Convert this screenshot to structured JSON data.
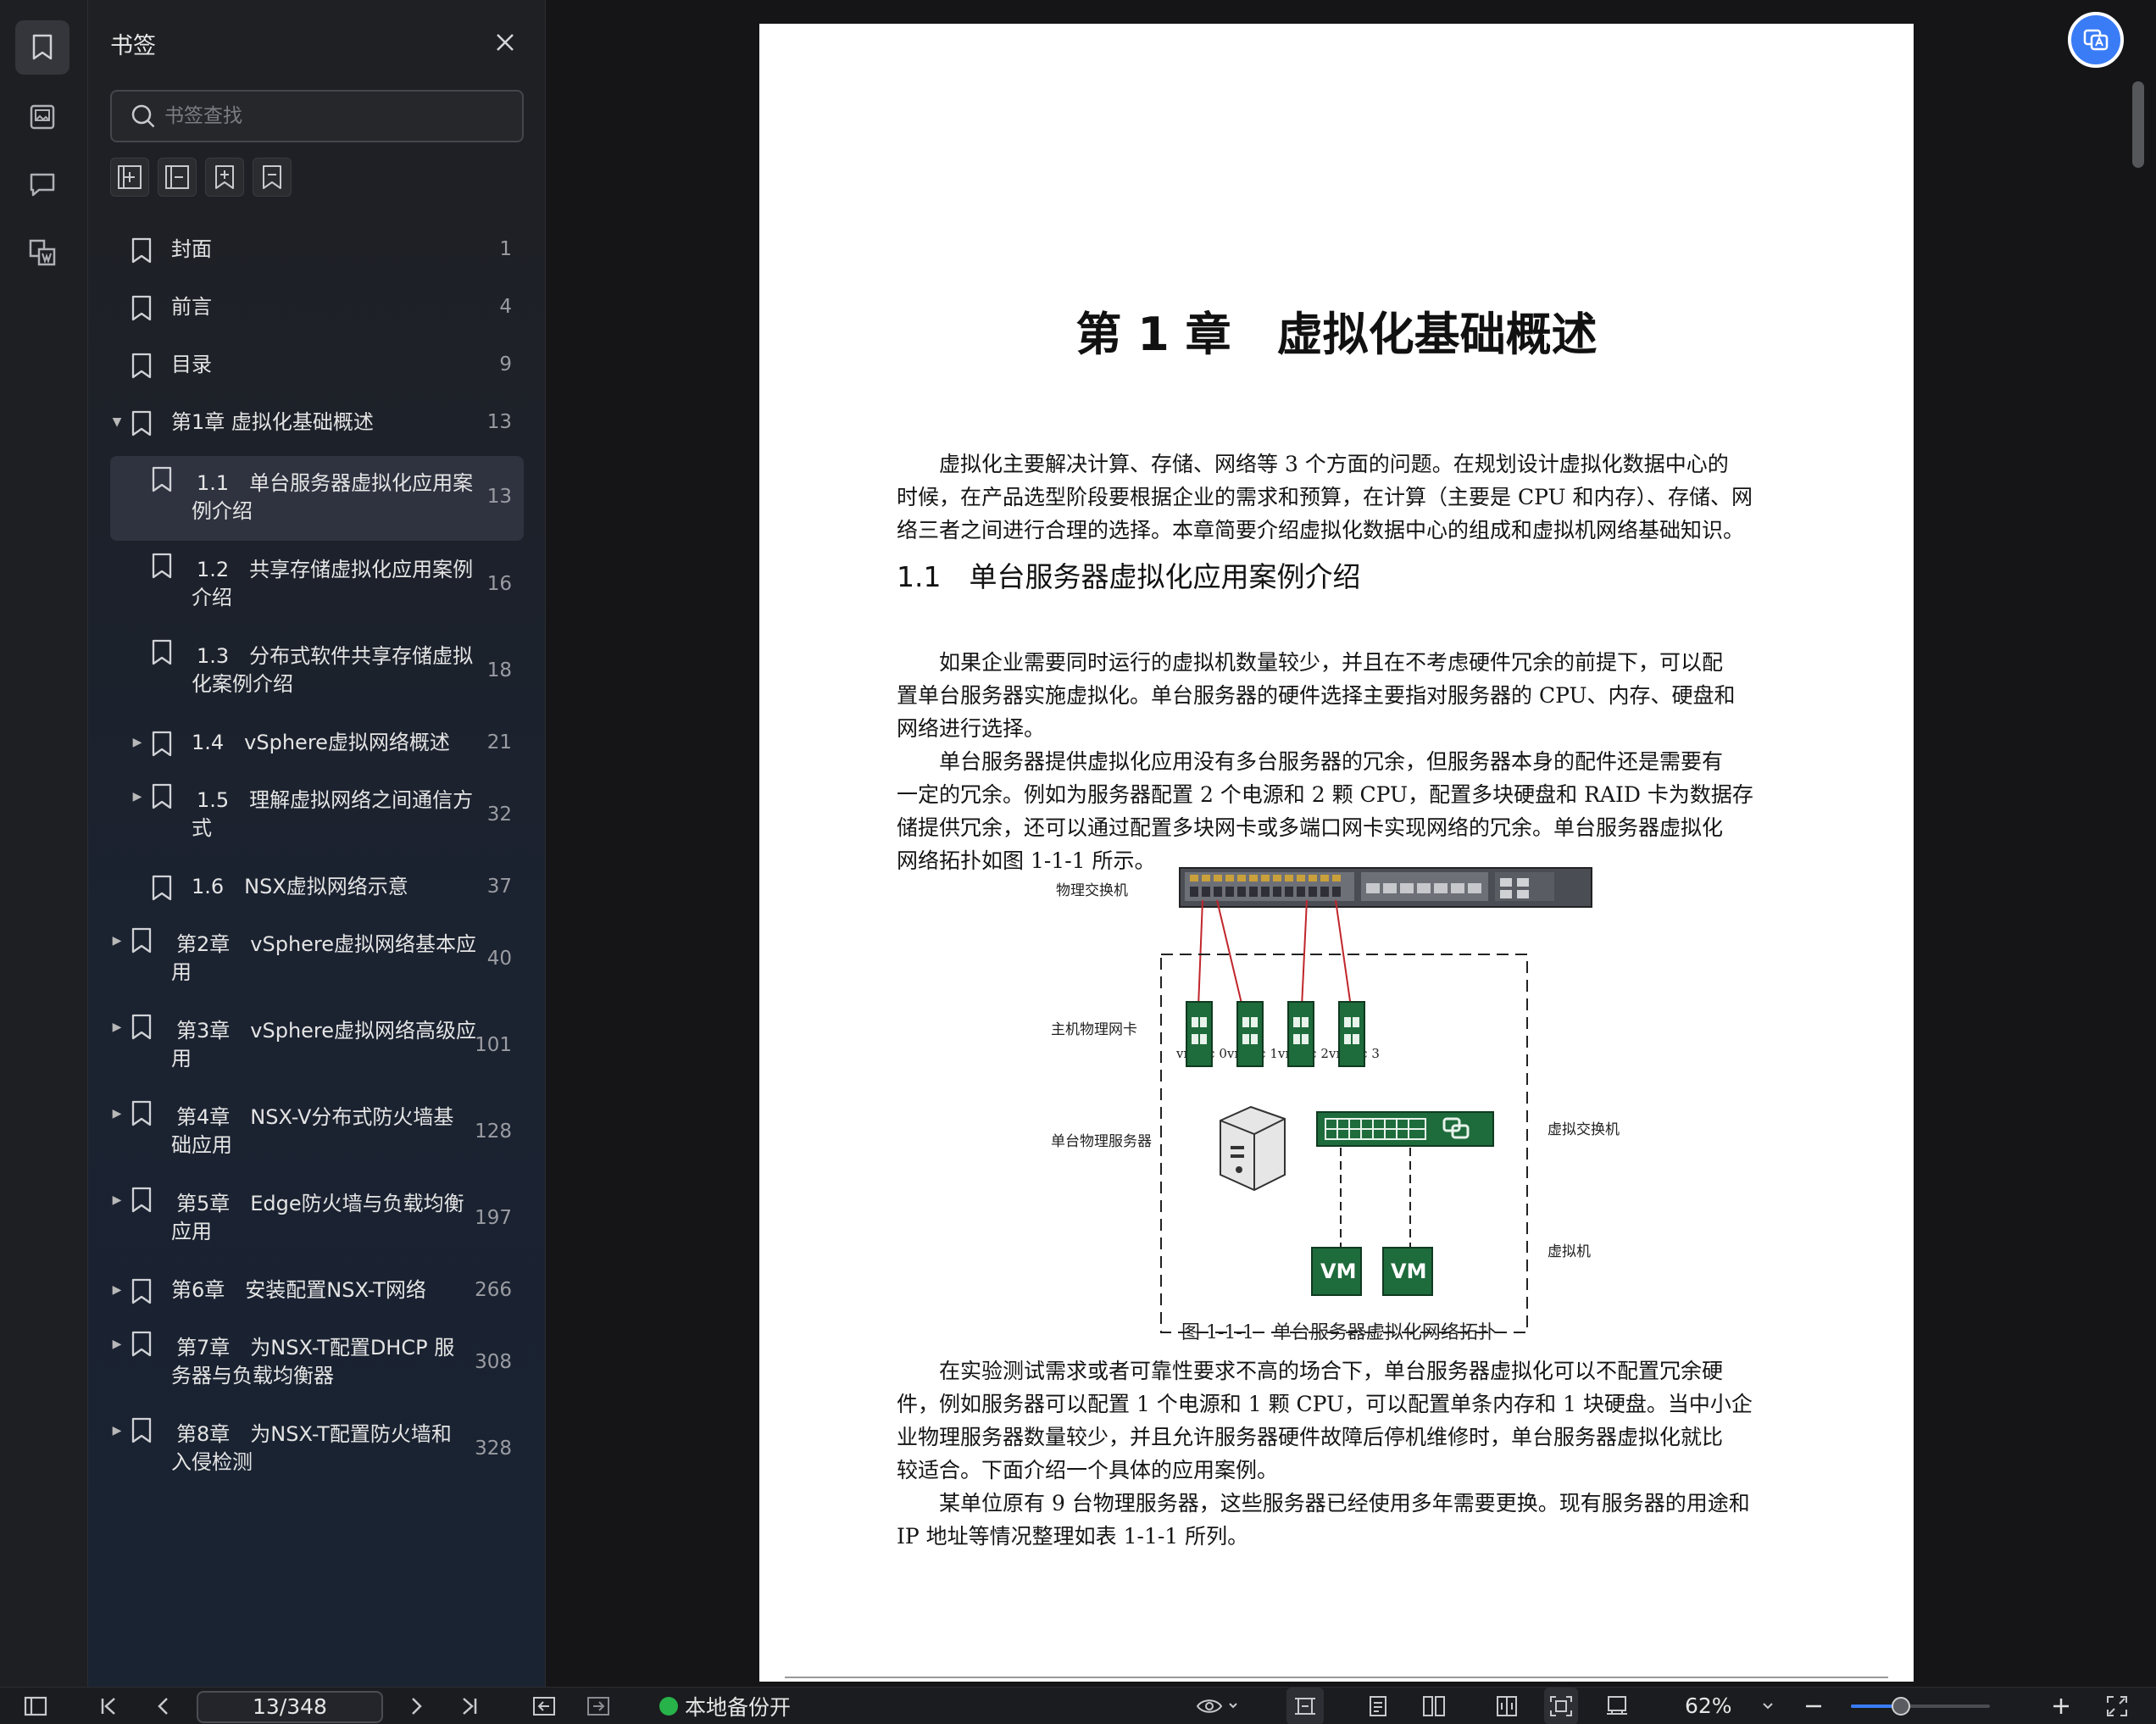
{
  "sidebar": {
    "title": "书签",
    "search_placeholder": "书签查找",
    "bookmarks": [
      {
        "label": "封面",
        "page": "1",
        "expandable": false,
        "expanded": false,
        "level": 0,
        "active": false
      },
      {
        "label": "前言",
        "page": "4",
        "expandable": false,
        "expanded": false,
        "level": 0,
        "active": false
      },
      {
        "label": "目录",
        "page": "9",
        "expandable": false,
        "expanded": false,
        "level": 0,
        "active": false
      },
      {
        "label": "第1章 虚拟化基础概述",
        "page": "13",
        "expandable": true,
        "expanded": true,
        "level": 0,
        "active": false
      },
      {
        "label1": "1.1　单台服务器虚拟化应用案",
        "label2": "例介绍",
        "page": "13",
        "expandable": false,
        "expanded": false,
        "level": 1,
        "active": true
      },
      {
        "label1": "1.2　共享存储虚拟化应用案例",
        "label2": "介绍",
        "page": "16",
        "expandable": false,
        "expanded": false,
        "level": 1,
        "active": false
      },
      {
        "label1": "1.3　分布式软件共享存储虚拟",
        "label2": "化案例介绍",
        "page": "18",
        "expandable": false,
        "expanded": false,
        "level": 1,
        "active": false
      },
      {
        "label": "1.4　vSphere虚拟网络概述",
        "page": "21",
        "expandable": true,
        "expanded": false,
        "level": 1,
        "active": false
      },
      {
        "label1": "1.5　理解虚拟网络之间通信方",
        "label2": "式",
        "page": "32",
        "expandable": true,
        "expanded": false,
        "level": 1,
        "active": false
      },
      {
        "label": "1.6　NSX虚拟网络示意",
        "page": "37",
        "expandable": false,
        "expanded": false,
        "level": 1,
        "active": false
      },
      {
        "label1": "第2章　vSphere虚拟网络基本应",
        "label2": "用",
        "page": "40",
        "expandable": true,
        "expanded": false,
        "level": 0,
        "active": false
      },
      {
        "label1": "第3章　vSphere虚拟网络高级应",
        "label2": "用",
        "page": "101",
        "expandable": true,
        "expanded": false,
        "level": 0,
        "active": false
      },
      {
        "label1": "第4章　NSX-V分布式防火墙基",
        "label2": "础应用",
        "page": "128",
        "expandable": true,
        "expanded": false,
        "level": 0,
        "active": false
      },
      {
        "label1": "第5章　Edge防火墙与负载均衡",
        "label2": "应用",
        "page": "197",
        "expandable": true,
        "expanded": false,
        "level": 0,
        "active": false
      },
      {
        "label": "第6章　安装配置NSX-T网络",
        "page": "266",
        "expandable": true,
        "expanded": false,
        "level": 0,
        "active": false
      },
      {
        "label1": "第7章　为NSX-T配置DHCP 服",
        "label2": "务器与负载均衡器",
        "page": "308",
        "expandable": true,
        "expanded": false,
        "level": 0,
        "active": false
      },
      {
        "label1": "第8章　为NSX-T配置防火墙和",
        "label2": "入侵检测",
        "page": "328",
        "expandable": true,
        "expanded": false,
        "level": 0,
        "active": false
      }
    ]
  },
  "document": {
    "chapter_title": "第 1 章　虚拟化基础概述",
    "intro": [
      "虚拟化主要解决计算、存储、网络等 3 个方面的问题。在规划设计虚拟化数据中心的",
      "时候，在产品选型阶段要根据企业的需求和预算，在计算（主要是 CPU 和内存）、存储、网",
      "络三者之间进行合理的选择。本章简要介绍虚拟化数据中心的组成和虚拟机网络基础知识。"
    ],
    "section_title": "1.1　单台服务器虚拟化应用案例介绍",
    "para1": [
      "如果企业需要同时运行的虚拟机数量较少，并且在不考虑硬件冗余的前提下，可以配",
      "置单台服务器实施虚拟化。单台服务器的硬件选择主要指对服务器的 CPU、内存、硬盘和",
      "网络进行选择。"
    ],
    "para2": [
      "单台服务器提供虚拟化应用没有多台服务器的冗余，但服务器本身的配件还是需要有",
      "一定的冗余。例如为服务器配置 2 个电源和 2 颗 CPU，配置多块硬盘和 RAID 卡为数据存",
      "储提供冗余，还可以通过配置多块网卡或多端口网卡实现网络的冗余。单台服务器虚拟化",
      "网络拓扑如图 1-1-1 所示。"
    ],
    "figure": {
      "label_switch": "物理交换机",
      "label_nic": "主机物理网卡",
      "label_server": "单台物理服务器",
      "label_vswitch": "虚拟交换机",
      "label_vm": "虚拟机",
      "nics": [
        "vmnic 0",
        "vmnic 1",
        "vmnic 2",
        "vmnic 3"
      ],
      "vm_text": "VM",
      "caption": "图 1-1-1　单台服务器虚拟化网络拓扑"
    },
    "para3": [
      "在实验测试需求或者可靠性要求不高的场合下，单台服务器虚拟化可以不配置冗余硬",
      "件，例如服务器可以配置 1 个电源和 1 颗 CPU，可以配置单条内存和 1 块硬盘。当中小企",
      "业物理服务器数量较少，并且允许服务器硬件故障后停机维修时，单台服务器虚拟化就比",
      "较适合。下面介绍一个具体的应用案例。"
    ],
    "para4": [
      "某单位原有 9 台物理服务器，这些服务器已经使用多年需要更换。现有服务器的用途和",
      "IP 地址等情况整理如表 1-1-1 所列。"
    ]
  },
  "statusbar": {
    "page_indicator": "13/348",
    "backup_label": "本地备份开",
    "zoom": "62%",
    "zoom_slider_fraction": 0.36
  },
  "colors": {
    "accent": "#3a7cf6",
    "backup_dot": "#27b24a",
    "nic_green": "#1e6b3c",
    "cable_red": "#c0262b"
  },
  "icons": [
    "bookmark-icon",
    "image-icon",
    "comment-icon",
    "attachment-icon",
    "close-icon",
    "search-icon",
    "add-bookmark-icon",
    "collapse-all-icon",
    "expand-all-icon",
    "bookmark-outline-icon",
    "sidebar-toggle-icon",
    "first-page-icon",
    "prev-page-icon",
    "next-page-icon",
    "last-page-icon",
    "back-icon",
    "forward-icon",
    "eye-icon",
    "fit-width-icon",
    "single-page-icon",
    "two-page-icon",
    "book-view-icon",
    "fit-page-icon",
    "rotate-icon",
    "zoom-out-icon",
    "zoom-in-icon",
    "fullscreen-icon",
    "translate-fab-icon"
  ]
}
